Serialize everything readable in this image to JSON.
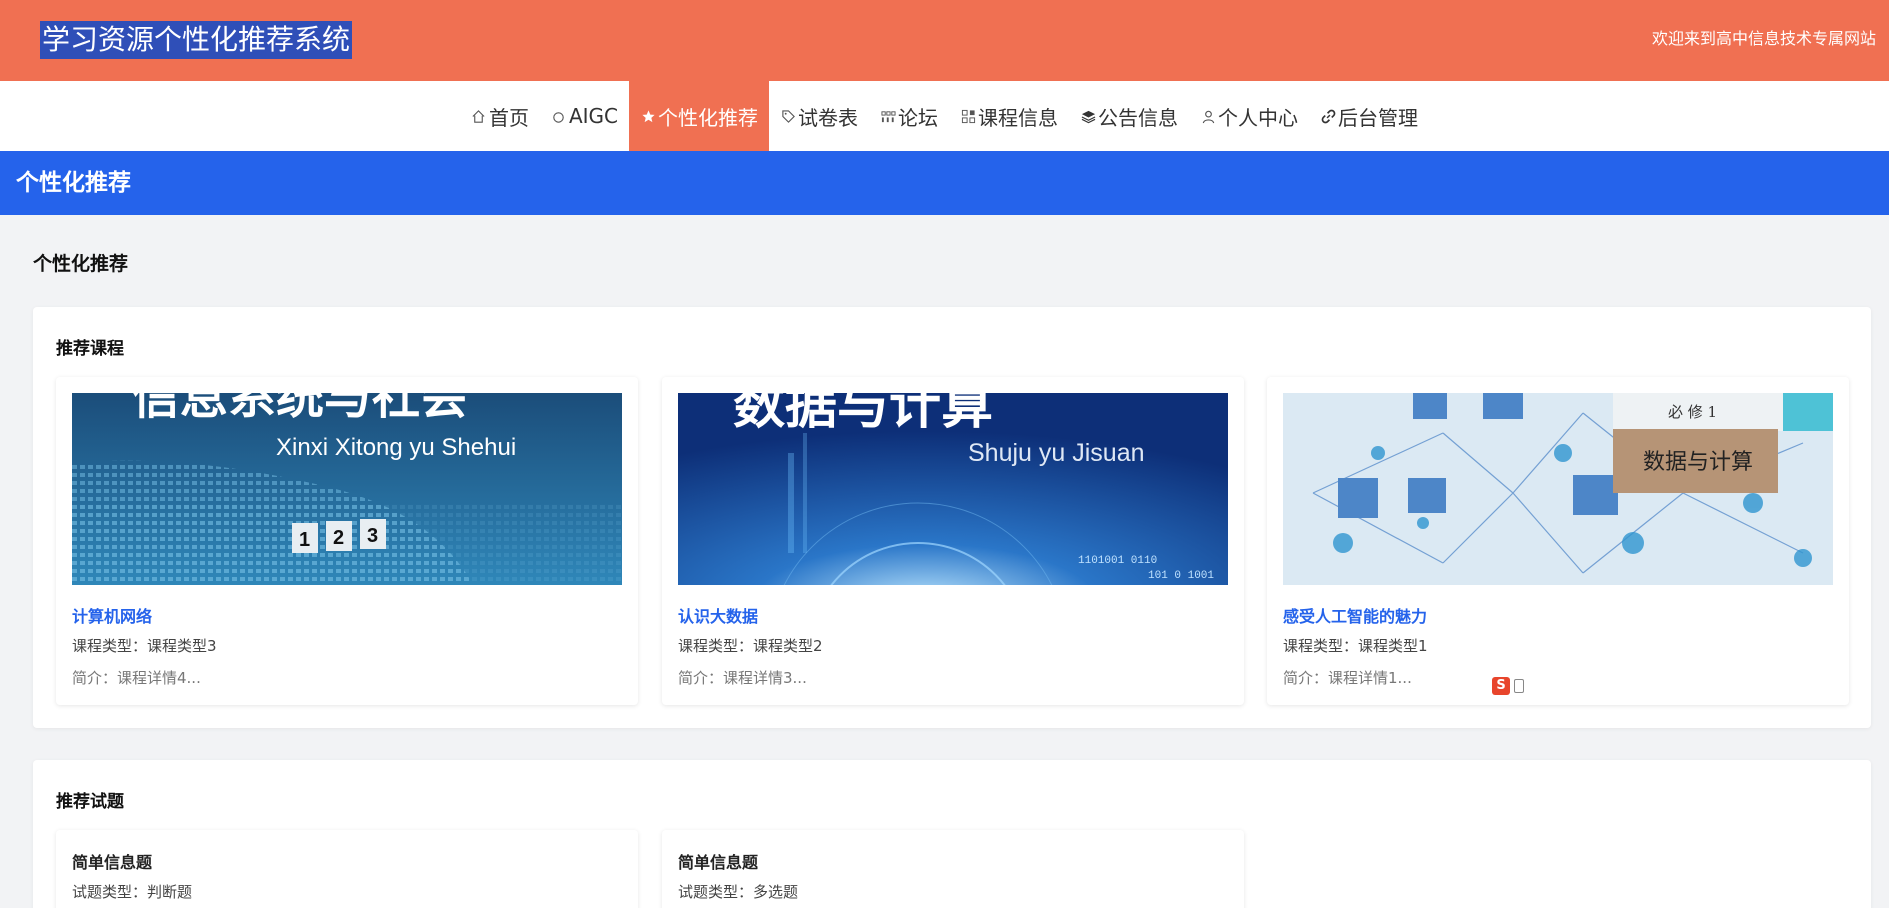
{
  "header": {
    "site_title": "学习资源个性化推荐系统",
    "welcome": "欢迎来到高中信息技术专属网站"
  },
  "nav": {
    "items": [
      {
        "label": "首页",
        "icon": "home-icon"
      },
      {
        "label": "AIGC",
        "icon": "circle-icon"
      },
      {
        "label": "个性化推荐",
        "icon": "star-icon",
        "active": true
      },
      {
        "label": "试卷表",
        "icon": "tag-icon"
      },
      {
        "label": "论坛",
        "icon": "grid-icon"
      },
      {
        "label": "课程信息",
        "icon": "apps-icon"
      },
      {
        "label": "公告信息",
        "icon": "layers-icon"
      },
      {
        "label": "个人中心",
        "icon": "user-icon"
      },
      {
        "label": "后台管理",
        "icon": "link-icon"
      }
    ]
  },
  "page": {
    "banner_title": "个性化推荐",
    "section_heading": "个性化推荐"
  },
  "recommended_courses": {
    "title": "推荐课程",
    "items": [
      {
        "name": "计算机网络",
        "type": "课程类型：课程类型3",
        "desc": "简介：课程详情4...",
        "image": {
          "headline": "信息系统与社会",
          "pinyin": "Xinxi Xitong  yu Shehui",
          "digits": [
            "1",
            "2",
            "3"
          ]
        }
      },
      {
        "name": "认识大数据",
        "type": "课程类型：课程类型2",
        "desc": "简介：课程详情3...",
        "image": {
          "headline": "数据与计算",
          "pinyin": "Shuju yu Jisuan",
          "digits": [
            "1101001 0110",
            "101 0 1001"
          ]
        }
      },
      {
        "name": "感受人工智能的魅力",
        "type": "课程类型：课程类型1",
        "desc": "简介：课程详情1...",
        "image": {
          "headline": "必 修 1",
          "subtitle": "数据与计算"
        }
      }
    ]
  },
  "recommended_questions": {
    "title": "推荐试题",
    "items": [
      {
        "name": "简单信息题",
        "type": "试题类型：判断题"
      },
      {
        "name": "简单信息题",
        "type": "试题类型：多选题"
      }
    ]
  },
  "ime": {
    "label": "S"
  },
  "colors": {
    "brand_orange": "#f07052",
    "primary_blue": "#2563eb",
    "title_highlight": "#2f4fb8",
    "background": "#f2f3f5"
  }
}
